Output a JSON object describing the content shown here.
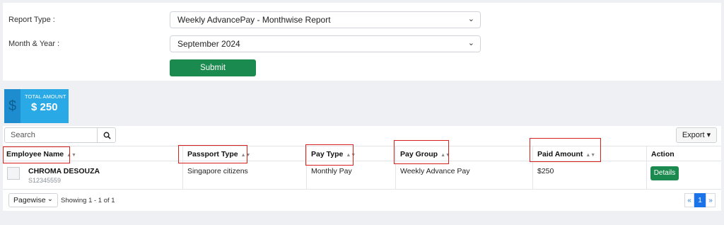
{
  "form": {
    "report_type_label": "Report Type :",
    "report_type_value": "Weekly AdvancePay - Monthwise Report",
    "month_year_label": "Month & Year :",
    "month_year_value": "September 2024",
    "submit_label": "Submit"
  },
  "summary": {
    "currency_symbol": "$",
    "total_label": "TOTAL AMOUNT",
    "total_value": "$ 250",
    "accent_color": "#29a9e6"
  },
  "toolbar": {
    "search_placeholder": "Search",
    "export_label": "Export ▾"
  },
  "table": {
    "headers": [
      "Employee Name",
      "Passport Type",
      "Pay Type",
      "Pay Group",
      "Paid Amount",
      "Action"
    ],
    "rows": [
      {
        "employee_name": "CHROMA DESOUZA",
        "employee_id": "S12345559",
        "passport_type": "Singapore citizens",
        "pay_type": "Monthly Pay",
        "pay_group": "Weekly Advance Pay",
        "paid_amount": "$250",
        "action_label": "Details"
      }
    ]
  },
  "footer": {
    "page_size_value": "Pagewise",
    "showing_text": "Showing 1 - 1 of 1",
    "pages": {
      "prev": "«",
      "current": "1",
      "next": "»"
    }
  },
  "colors": {
    "primary_button": "#1a8a4e",
    "highlight_box": "#d8201c",
    "pager_active": "#1a73e8"
  }
}
